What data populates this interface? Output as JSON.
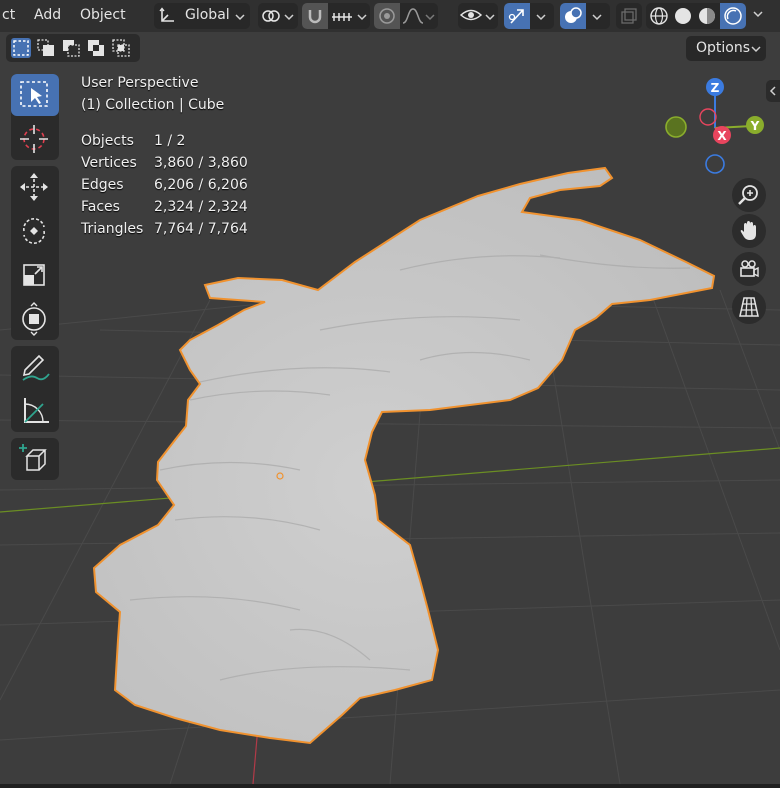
{
  "header": {
    "menus": [
      "ct",
      "Add",
      "Object"
    ],
    "transform_orientation": "Global"
  },
  "options_label": "Options",
  "overlay": {
    "view_name": "User Perspective",
    "collection_line": "(1) Collection | Cube",
    "stats": [
      {
        "label": "Objects",
        "value": "1 / 2"
      },
      {
        "label": "Vertices",
        "value": "3,860 / 3,860"
      },
      {
        "label": "Edges",
        "value": "6,206 / 6,206"
      },
      {
        "label": "Faces",
        "value": "2,324 / 2,324"
      },
      {
        "label": "Triangles",
        "value": "7,764 / 7,764"
      }
    ]
  },
  "gizmo": {
    "z": "Z",
    "y": "Y",
    "x": "X"
  },
  "toolbar": [
    "select-box",
    "cursor",
    "move",
    "rotate",
    "scale",
    "transform",
    "annotate",
    "measure",
    "add-cube"
  ],
  "colors": {
    "active_blue": "#4772b3",
    "selection_outline": "#f0922f",
    "axis_x": "#e8455e",
    "axis_y": "#8aad2c",
    "axis_z": "#3b7be0",
    "mesh": "#c9c9c9",
    "viewport_bg": "#3d3d3d"
  }
}
